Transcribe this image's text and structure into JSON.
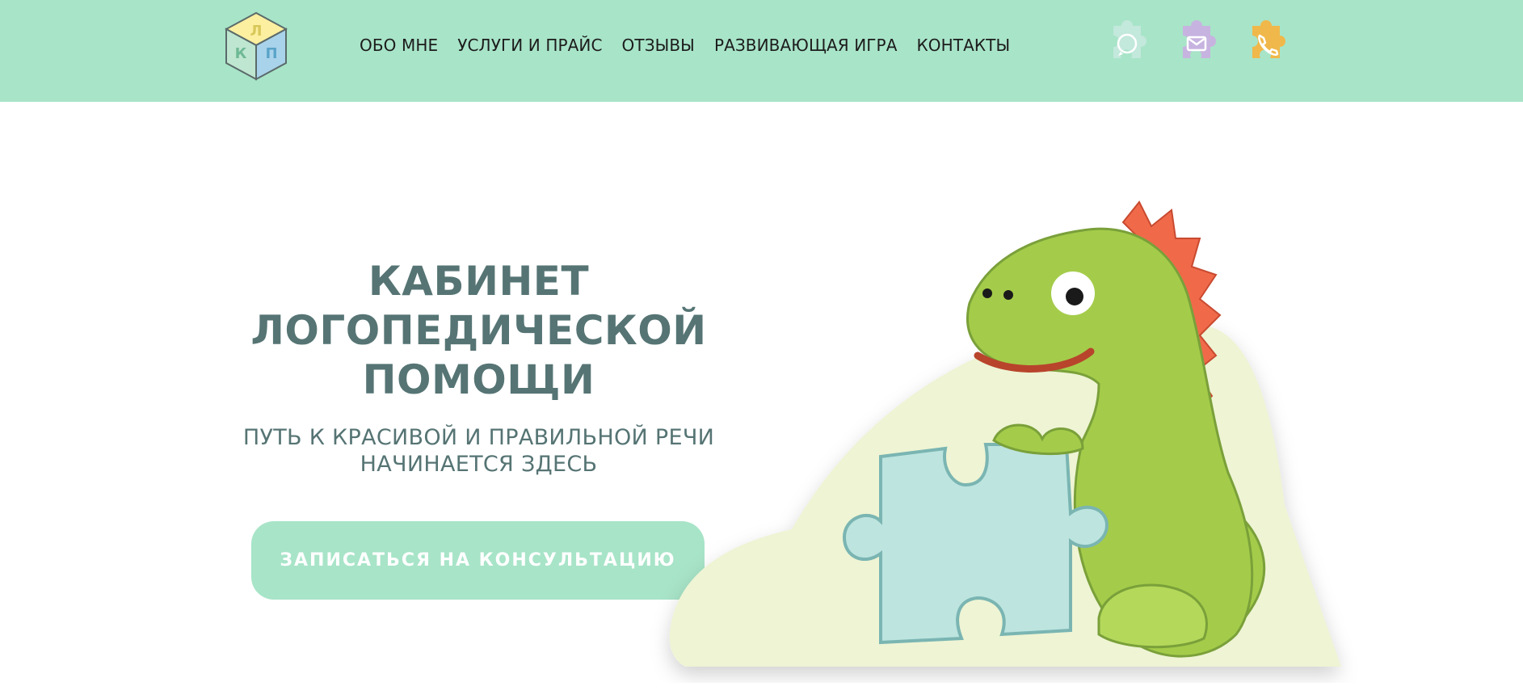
{
  "logo": {
    "letters": [
      "Л",
      "К",
      "П"
    ]
  },
  "nav": [
    {
      "label": "ОБО МНЕ"
    },
    {
      "label": "УСЛУГИ И ПРАЙС"
    },
    {
      "label": "ОТЗЫВЫ"
    },
    {
      "label": "РАЗВИВАЮЩАЯ ИГРА"
    },
    {
      "label": "КОНТАКТЫ"
    }
  ],
  "socials": [
    {
      "icon": "whatsapp-icon",
      "color": "#c3e8dc"
    },
    {
      "icon": "mail-icon",
      "color": "#c7b3e0"
    },
    {
      "icon": "phone-icon",
      "color": "#f0b84a"
    }
  ],
  "hero": {
    "title_lines": [
      "КАБИНЕТ",
      "ЛОГОПЕДИЧЕСКОЙ",
      "ПОМОЩИ"
    ],
    "subtitle_lines": [
      "ПУТЬ К КРАСИВОЙ И ПРАВИЛЬНОЙ РЕЧИ",
      "НАЧИНАЕТСЯ ЗДЕСЬ"
    ],
    "cta_label": "ЗАПИСАТЬСЯ НА КОНСУЛЬТАЦИЮ"
  },
  "colors": {
    "header_bg": "#a8e4c8",
    "text_primary": "#567474",
    "dino_green": "#a4cc4a",
    "dino_spikes": "#f06a4a",
    "puzzle_blue": "#bde4df",
    "backdrop": "#eef4d4"
  }
}
